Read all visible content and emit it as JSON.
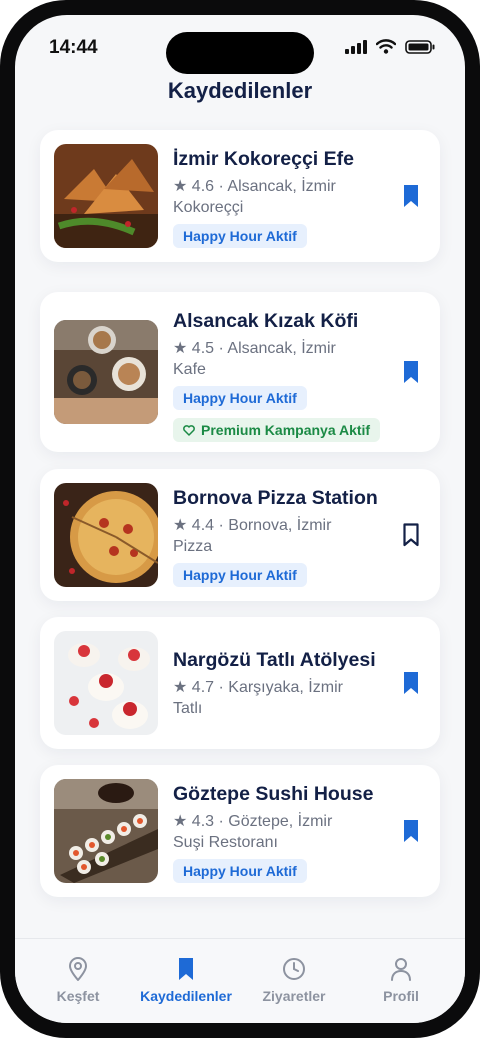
{
  "status": {
    "time": "14:44",
    "icons": [
      "signal-icon",
      "wifi-icon",
      "battery-icon"
    ]
  },
  "page": {
    "title": "Kaydedilenler"
  },
  "colors": {
    "accent": "#1e6ad6",
    "title": "#132046",
    "premium": "#1b8a45"
  },
  "saved": [
    {
      "name": "İzmir Kokoreççi Efe",
      "rating": "4.6",
      "location": "Alsancak, İzmir",
      "category": "Kokoreççi",
      "badge": "Happy Hour Aktif",
      "premium": "",
      "bookmarked": true,
      "image": "kokorec-food-photo"
    },
    {
      "name": "Alsancak Kızak Köfi",
      "rating": "4.5",
      "location": "Alsancak, İzmir",
      "category": "Kafe",
      "badge": "Happy Hour Aktif",
      "premium": "Premium Kampanya Aktif",
      "bookmarked": true,
      "image": "coffee-cups-photo"
    },
    {
      "name": "Bornova Pizza Station",
      "rating": "4.4",
      "location": "Bornova, İzmir",
      "category": "Pizza",
      "badge": "Happy Hour Aktif",
      "premium": "",
      "bookmarked": false,
      "image": "pizza-photo"
    },
    {
      "name": "Nargözü Tatlı Atölyesi",
      "rating": "4.7",
      "location": "Karşıyaka, İzmir",
      "category": "Tatlı",
      "badge": "",
      "premium": "",
      "bookmarked": true,
      "image": "dessert-cups-photo"
    },
    {
      "name": "Göztepe Sushi House",
      "rating": "4.3",
      "location": "Göztepe, İzmir",
      "category": "Suşi Restoranı",
      "badge": "Happy Hour Aktif",
      "premium": "",
      "bookmarked": true,
      "image": "sushi-photo"
    }
  ],
  "tabs": [
    {
      "label": "Keşfet",
      "icon": "map-pin-icon",
      "active": false
    },
    {
      "label": "Kaydedilenler",
      "icon": "bookmark-icon",
      "active": true
    },
    {
      "label": "Ziyaretler",
      "icon": "clock-icon",
      "active": false
    },
    {
      "label": "Profil",
      "icon": "user-icon",
      "active": false
    }
  ]
}
